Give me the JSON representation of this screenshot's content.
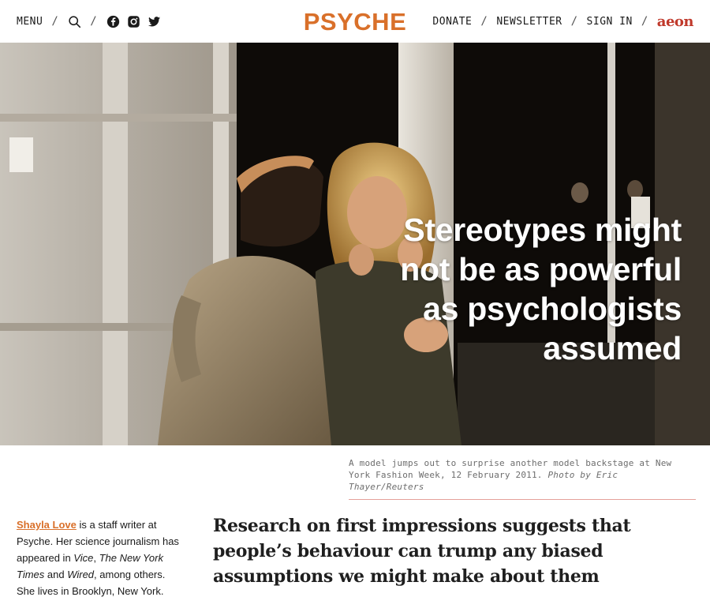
{
  "header": {
    "menu_label": "MENU",
    "sep": "/",
    "logo": "PSYCHE",
    "donate_label": "DONATE",
    "newsletter_label": "NEWSLETTER",
    "signin_label": "SIGN IN",
    "partner_logo": "aeon",
    "icons": [
      "search-icon",
      "facebook-icon",
      "instagram-icon",
      "twitter-icon"
    ]
  },
  "hero": {
    "title": "Stereotypes might not be as powerful as psychologists assumed"
  },
  "caption": {
    "text": "A model jumps out to surprise another model backstage at New York Fashion Week, 12 February 2011.",
    "credit": "Photo by Eric Thayer/Reuters"
  },
  "bio": {
    "author": "Shayla Love",
    "part1": " is a staff writer at Psyche. Her science journalism has appeared in ",
    "pub1": "Vice",
    "comma1": ", ",
    "pub2": "The New York Times",
    "and": " and ",
    "pub3": "Wired",
    "part2": ", among others. She lives in Brooklyn, New York."
  },
  "standfirst": "Research on first impressions suggests that people’s behaviour can trump any biased assumptions we might make about them",
  "colors": {
    "brand": "#d9702a",
    "partner": "#c0392b",
    "caption_rule": "#e5a19a"
  }
}
